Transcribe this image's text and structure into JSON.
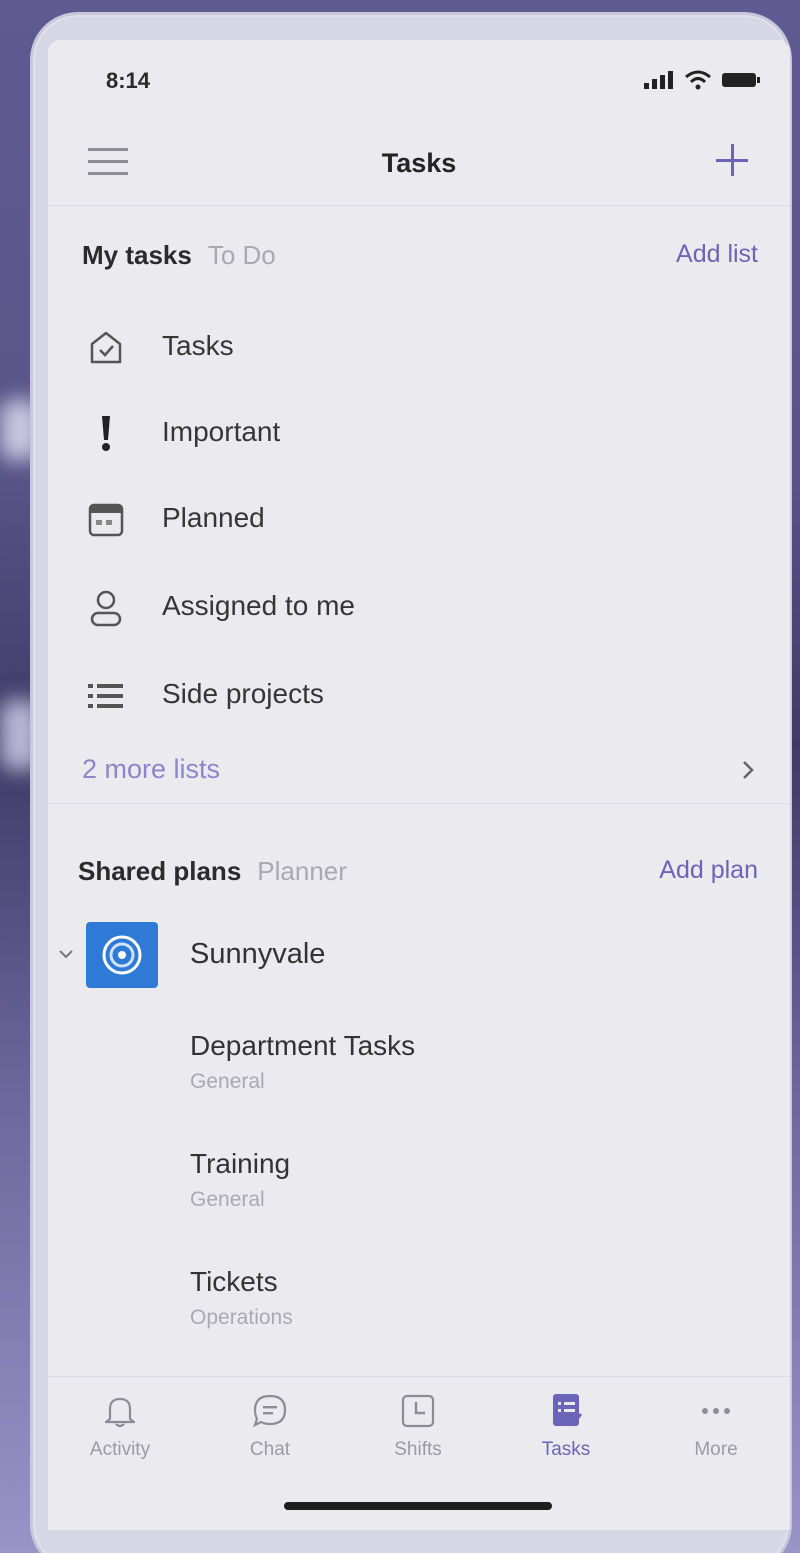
{
  "status": {
    "time": "8:14"
  },
  "header": {
    "title": "Tasks"
  },
  "my_tasks": {
    "title": "My tasks",
    "subtitle": "To Do",
    "action": "Add list",
    "items": [
      {
        "label": "Tasks",
        "icon": "house-check-icon"
      },
      {
        "label": "Important",
        "icon": "exclamation-icon"
      },
      {
        "label": "Planned",
        "icon": "calendar-icon"
      },
      {
        "label": "Assigned to me",
        "icon": "person-icon"
      },
      {
        "label": "Side projects",
        "icon": "list-icon"
      }
    ],
    "more": "2 more lists"
  },
  "shared_plans": {
    "title": "Shared plans",
    "subtitle": "Planner",
    "action": "Add plan",
    "group": "Sunnyvale",
    "plans": [
      {
        "name": "Department Tasks",
        "team": "General"
      },
      {
        "name": "Training",
        "team": "General"
      },
      {
        "name": "Tickets",
        "team": "Operations"
      }
    ]
  },
  "tabs": [
    {
      "label": "Activity",
      "icon": "bell-icon",
      "active": false
    },
    {
      "label": "Chat",
      "icon": "chat-icon",
      "active": false
    },
    {
      "label": "Shifts",
      "icon": "clock-icon",
      "active": false
    },
    {
      "label": "Tasks",
      "icon": "tasks-icon",
      "active": true
    },
    {
      "label": "More",
      "icon": "more-icon",
      "active": false
    }
  ],
  "colors": {
    "accent": "#6b64b8",
    "plan_avatar": "#2e7ad6",
    "screen_bg": "#ebeaef"
  }
}
